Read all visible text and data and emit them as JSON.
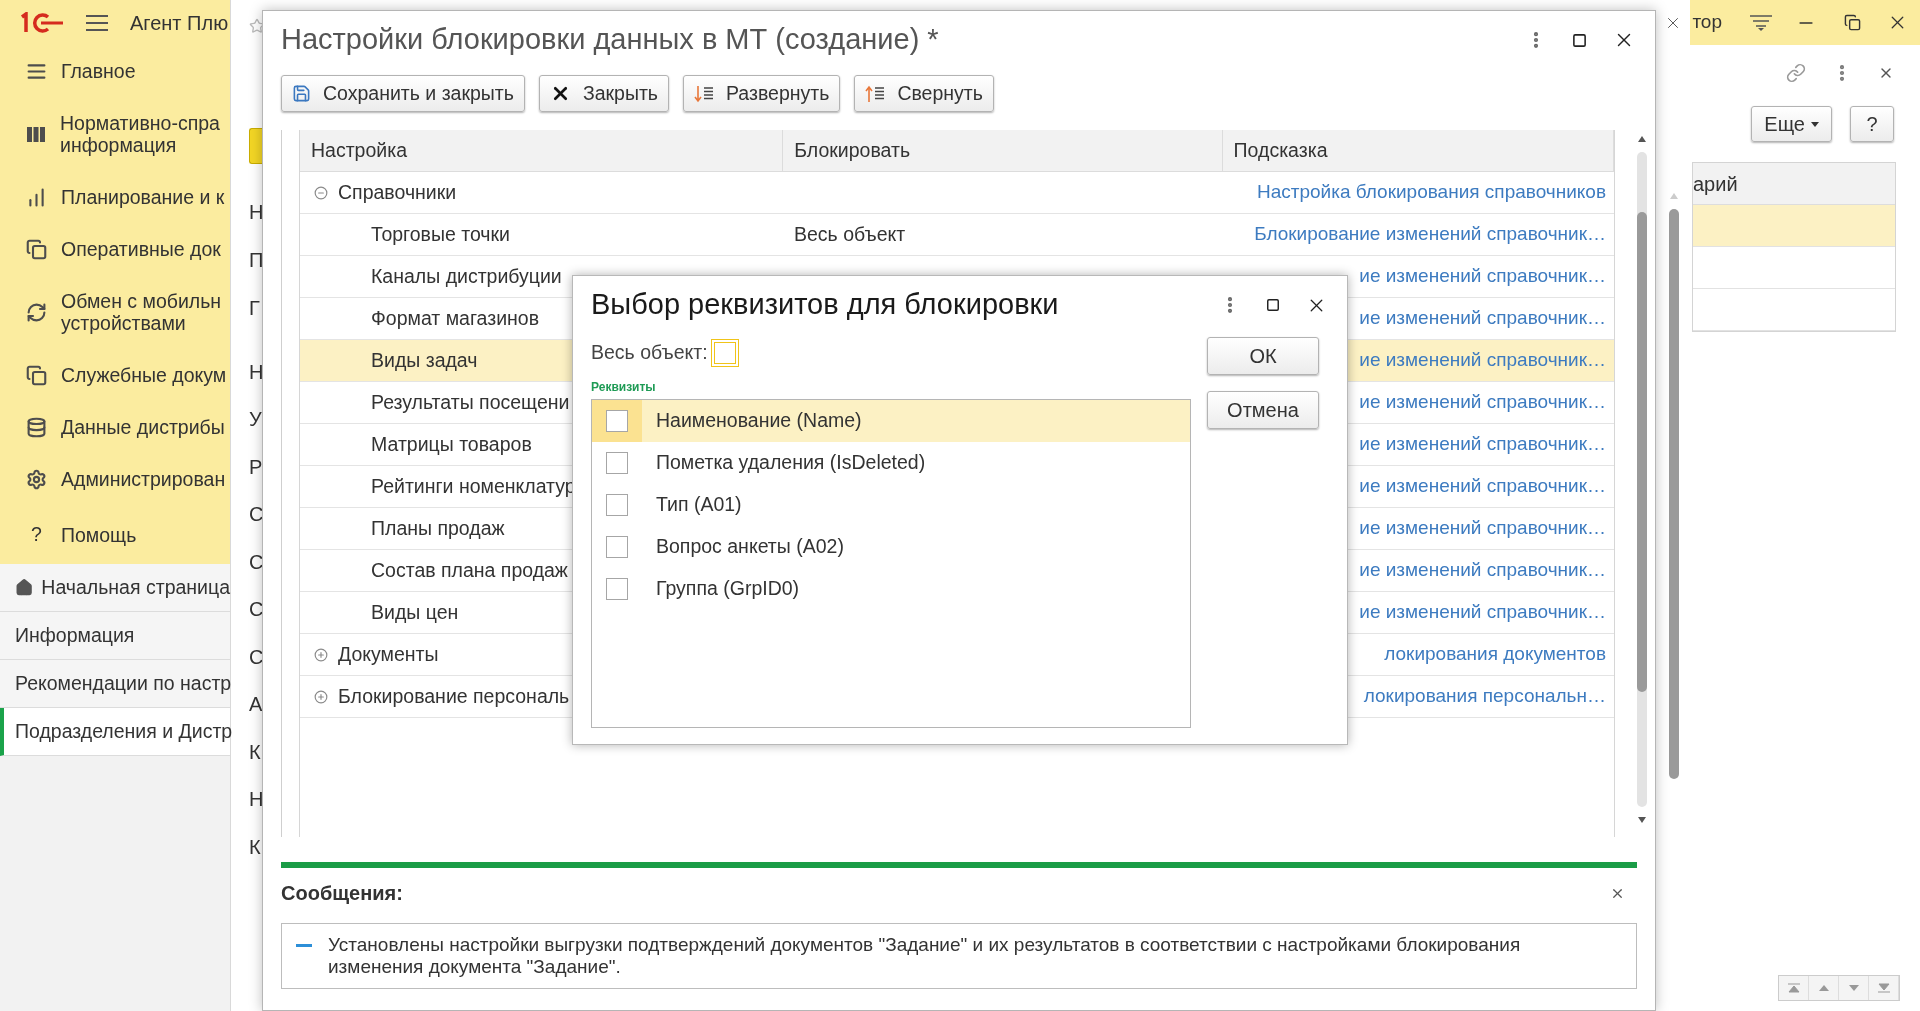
{
  "top_bar": {
    "app_title": "Агент Плю"
  },
  "sidebar": {
    "sections": [
      {
        "lines": [
          "Главное"
        ]
      },
      {
        "lines": [
          "Нормативно-спра",
          "информация"
        ]
      },
      {
        "lines": [
          "Планирование и к"
        ]
      },
      {
        "lines": [
          "Оперативные док"
        ]
      },
      {
        "lines": [
          "Обмен с мобильн",
          "устройствами"
        ]
      },
      {
        "lines": [
          "Служебные докум"
        ]
      },
      {
        "lines": [
          "Данные дистрибы"
        ]
      },
      {
        "lines": [
          "Администрирован"
        ]
      },
      {
        "lines": [
          "Помощь"
        ],
        "glyph": "?"
      }
    ],
    "pages": [
      {
        "label": "Начальная страница",
        "kind": "home",
        "selected": false
      },
      {
        "label": "Информация",
        "kind": "page",
        "selected": false
      },
      {
        "label": "Рекомендации по настр",
        "kind": "page",
        "selected": false
      },
      {
        "label": "Подразделения и Дистр",
        "kind": "page",
        "selected": true
      }
    ]
  },
  "background_form": {
    "fragments_upper": [
      "Н",
      "П",
      "Г"
    ],
    "fragments_lower": [
      "Н",
      "У",
      "Р",
      "С",
      "С",
      "С",
      "С",
      "А",
      "К",
      "Н",
      "К"
    ]
  },
  "right_panel": {
    "top_text": "тор",
    "more_button": "Еще",
    "help_button": "?",
    "column_header": "арий",
    "rows": [
      {
        "selected": true
      },
      {
        "selected": false
      },
      {
        "selected": false
      }
    ]
  },
  "dialog": {
    "title": "Настройки блокировки данных в МТ (создание) *",
    "toolbar": [
      {
        "label": "Сохранить и закрыть",
        "kind": "save"
      },
      {
        "label": "Закрыть",
        "kind": "close"
      },
      {
        "label": "Развернуть",
        "kind": "expand"
      },
      {
        "label": "Свернуть",
        "kind": "collapse"
      }
    ],
    "table": {
      "columns": [
        "Настройка",
        "Блокировать",
        "Подсказка"
      ],
      "rows": [
        {
          "setting": "Справочники",
          "hint": "Настройка блокирования справочников",
          "expanded": true,
          "selected": false,
          "children": [
            {
              "setting": "Торговые точки",
              "block": "Весь объект",
              "hint": "Блокирование изменений справочник…",
              "selected": false
            },
            {
              "setting": "Каналы дистрибуции",
              "hint": "ие изменений справочник…",
              "selected": false
            },
            {
              "setting": "Формат магазинов",
              "hint": "ие изменений справочник…",
              "selected": false
            },
            {
              "setting": "Виды задач",
              "hint": "ие изменений справочник…",
              "selected": true
            },
            {
              "setting": "Результаты посещени",
              "hint": "ие изменений справочник…",
              "selected": false
            },
            {
              "setting": "Матрицы товаров",
              "hint": "ие изменений справочник…",
              "selected": false
            },
            {
              "setting": "Рейтинги номенклатур",
              "hint": "ие изменений справочник…",
              "selected": false
            },
            {
              "setting": "Планы продаж",
              "hint": "ие изменений справочник…",
              "selected": false
            },
            {
              "setting": "Состав плана продаж",
              "hint": "ие изменений справочник…",
              "selected": false
            },
            {
              "setting": "Виды цен",
              "hint": "ие изменений справочник…",
              "selected": false
            }
          ]
        },
        {
          "setting": "Документы",
          "hint": "локирования документов",
          "expanded": false,
          "selected": false
        },
        {
          "setting": "Блокирование персональ",
          "hint": "локирования персональн…",
          "expanded": false,
          "selected": false
        }
      ]
    },
    "messages": {
      "title": "Сообщения:",
      "items": [
        "Установлены настройки выгрузки подтверждений документов \"Задание\" и их результатов в соответствии с настройками блокирования изменения документа \"Задание\"."
      ]
    }
  },
  "subdialog": {
    "title": "Выбор реквизитов для блокировки",
    "whole_object": {
      "label": "Весь объект:",
      "checked": false
    },
    "group_label": "Реквизиты",
    "attributes": [
      {
        "label": "Наименование (Name)",
        "checked": false,
        "selected": true
      },
      {
        "label": "Пометка удаления (IsDeleted)",
        "checked": false,
        "selected": false
      },
      {
        "label": "Тип (A01)",
        "checked": false,
        "selected": false
      },
      {
        "label": "Вопрос анкеты (A02)",
        "checked": false,
        "selected": false
      },
      {
        "label": "Группа (GrpID0)",
        "checked": false,
        "selected": false
      }
    ],
    "buttons": [
      "ОК",
      "Отмена"
    ]
  }
}
